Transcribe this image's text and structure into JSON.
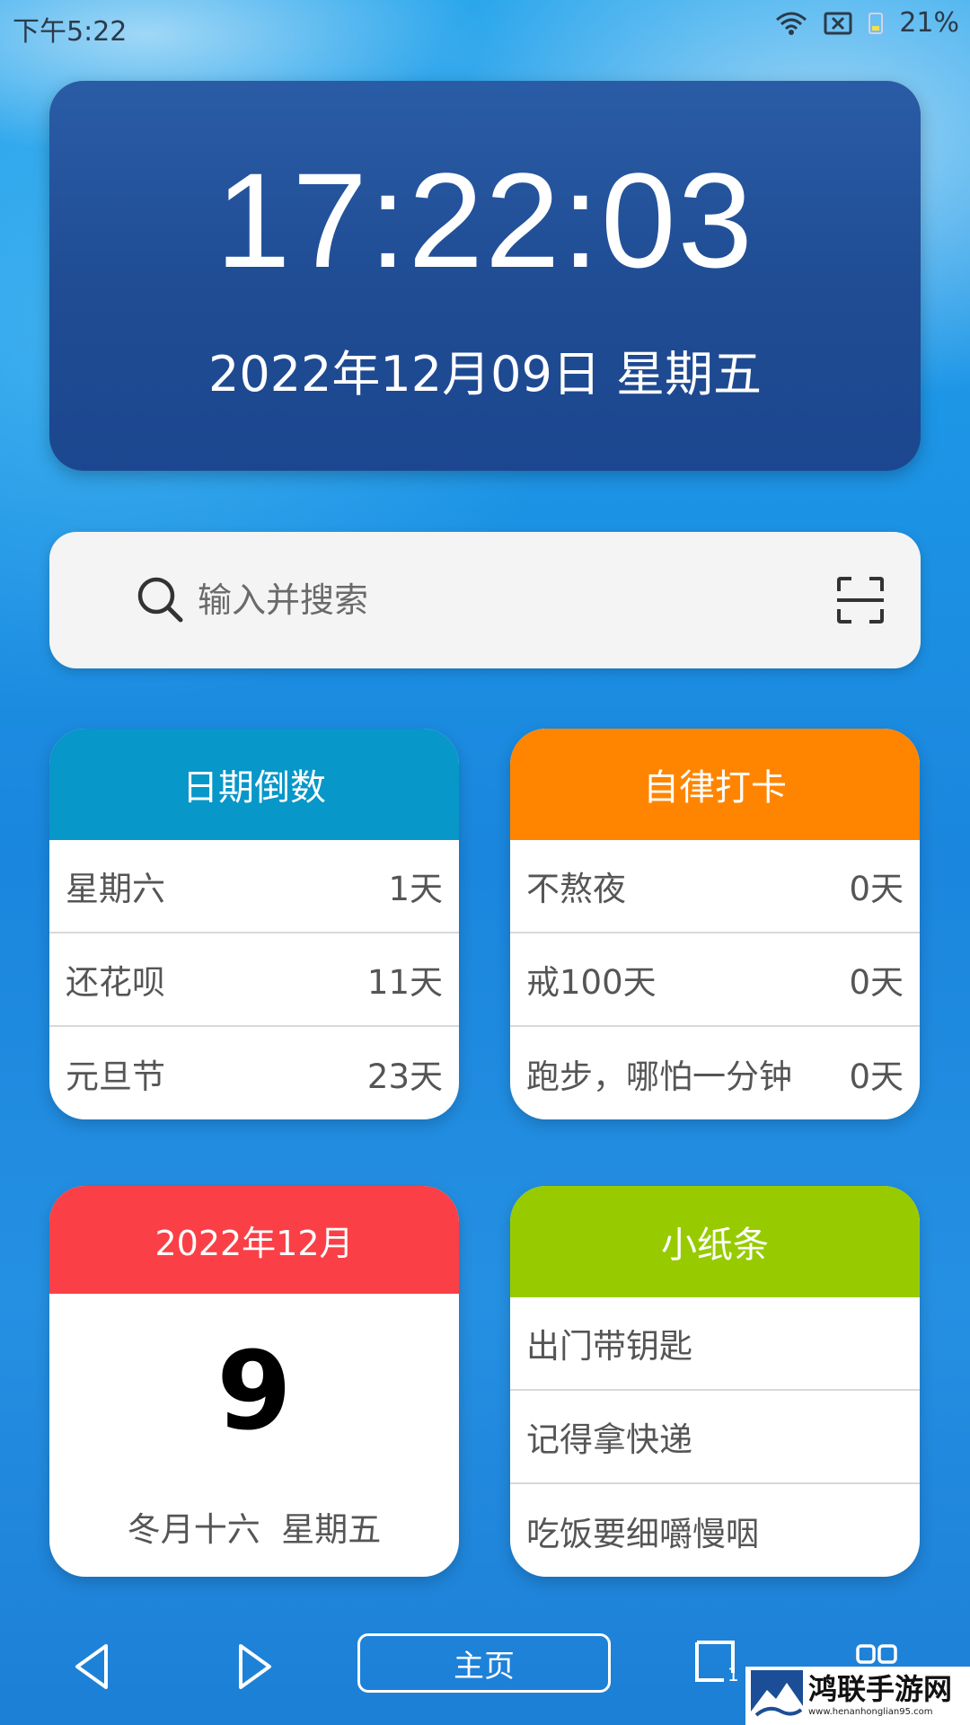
{
  "status_bar": {
    "time": "下午5:22",
    "battery": "21%"
  },
  "clock": {
    "time": "17:22:03",
    "date": "2022年12月09日 星期五"
  },
  "search": {
    "placeholder": "输入并搜索"
  },
  "countdown": {
    "title": "日期倒数",
    "items": [
      {
        "label": "星期六",
        "value": "1天"
      },
      {
        "label": "还花呗",
        "value": "11天"
      },
      {
        "label": "元旦节",
        "value": "23天"
      }
    ]
  },
  "checkin": {
    "title": "自律打卡",
    "items": [
      {
        "label": "不熬夜",
        "value": "0天"
      },
      {
        "label": "戒100天",
        "value": "0天"
      },
      {
        "label": "跑步，哪怕一分钟",
        "value": "0天"
      }
    ]
  },
  "calendar": {
    "month": "2022年12月",
    "day": "9",
    "lunar": "冬月十六  星期五"
  },
  "notes": {
    "title": "小纸条",
    "items": [
      "出门带钥匙",
      "记得拿快递",
      "吃饭要细嚼慢咽"
    ]
  },
  "nav": {
    "home": "主页",
    "tab_count": "1"
  },
  "watermark": {
    "title": "鸿联手游网",
    "url": "www.henanhonglian95.com"
  },
  "colors": {
    "countdown_header": "#0797c9",
    "checkin_header": "#ff8500",
    "calendar_header": "#fb3f46",
    "notes_header": "#97cb00",
    "clock_card": "#1f4c93"
  }
}
